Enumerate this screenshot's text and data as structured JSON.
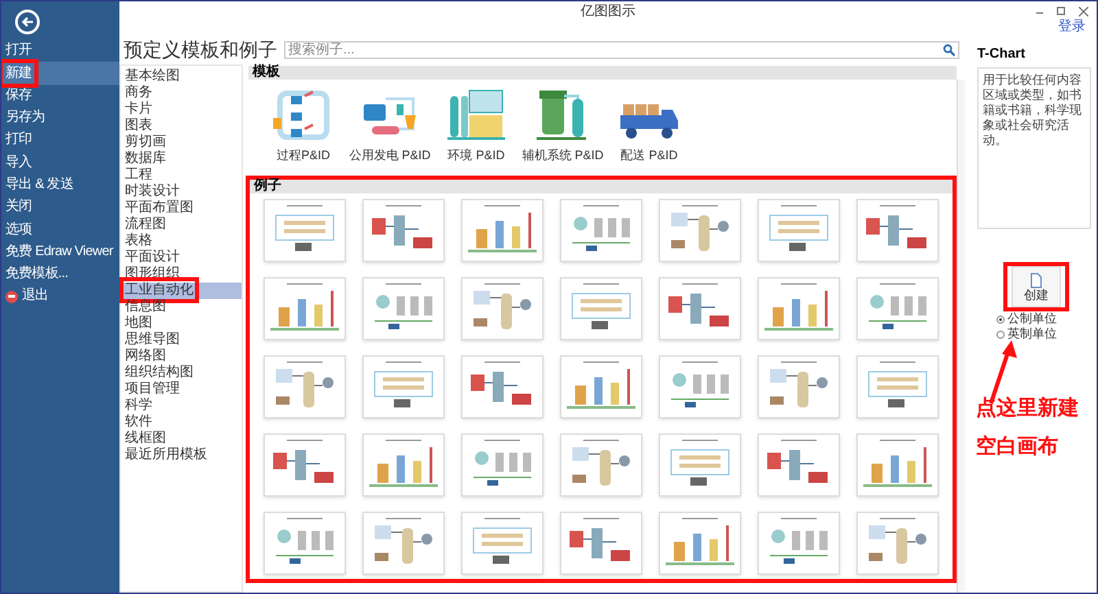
{
  "window": {
    "title": "亿图图示",
    "login": "登录"
  },
  "file_menu": [
    {
      "label": "打开",
      "selected": false,
      "kind": "plain"
    },
    {
      "label": "新建",
      "selected": true,
      "kind": "plain"
    },
    {
      "label": "保存",
      "selected": false,
      "kind": "plain"
    },
    {
      "label": "另存为",
      "selected": false,
      "kind": "plain"
    },
    {
      "label": "打印",
      "selected": false,
      "kind": "plain"
    },
    {
      "label": "导入",
      "selected": false,
      "kind": "plain"
    },
    {
      "label": "导出 & 发送",
      "selected": false,
      "kind": "plain"
    },
    {
      "label": "关闭",
      "selected": false,
      "kind": "plain"
    },
    {
      "label": "选项",
      "selected": false,
      "kind": "plain"
    },
    {
      "label": "免费 Edraw Viewer",
      "selected": false,
      "kind": "plain"
    },
    {
      "label": "免费模板...",
      "selected": false,
      "kind": "plain"
    },
    {
      "label": "退出",
      "selected": false,
      "kind": "exit"
    }
  ],
  "page_title": "预定义模板和例子",
  "search": {
    "placeholder": "搜索例子..."
  },
  "categories": [
    {
      "label": "基本绘图",
      "selected": false
    },
    {
      "label": "商务",
      "selected": false
    },
    {
      "label": "卡片",
      "selected": false
    },
    {
      "label": "图表",
      "selected": false
    },
    {
      "label": "剪切画",
      "selected": false
    },
    {
      "label": "数据库",
      "selected": false
    },
    {
      "label": "工程",
      "selected": false
    },
    {
      "label": "时装设计",
      "selected": false
    },
    {
      "label": "平面布置图",
      "selected": false
    },
    {
      "label": "流程图",
      "selected": false
    },
    {
      "label": "表格",
      "selected": false
    },
    {
      "label": "平面设计",
      "selected": false
    },
    {
      "label": "图形组织",
      "selected": false
    },
    {
      "label": "工业自动化",
      "selected": true
    },
    {
      "label": "信息图",
      "selected": false
    },
    {
      "label": "地图",
      "selected": false
    },
    {
      "label": "思维导图",
      "selected": false
    },
    {
      "label": "网络图",
      "selected": false
    },
    {
      "label": "组织结构图",
      "selected": false
    },
    {
      "label": "项目管理",
      "selected": false
    },
    {
      "label": "科学",
      "selected": false
    },
    {
      "label": "软件",
      "selected": false
    },
    {
      "label": "线框图",
      "selected": false
    },
    {
      "label": "最近所用模板",
      "selected": false
    }
  ],
  "templates": {
    "title": "模板",
    "items": [
      {
        "label": "过程P&ID",
        "kind": "process"
      },
      {
        "label": "公用发电 P&ID",
        "kind": "power"
      },
      {
        "label": "环境 P&ID",
        "kind": "environment"
      },
      {
        "label": "辅机系统 P&ID",
        "kind": "auxiliary"
      },
      {
        "label": "配送 P&ID",
        "kind": "delivery"
      }
    ]
  },
  "examples": {
    "title": "例子"
  },
  "details": {
    "title": "T-Chart",
    "description": "用于比较任何内容区域或类型，如书籍或书籍，科学现象或社会研究活动。",
    "create_button": "创建",
    "units": [
      {
        "label": "公制单位",
        "selected": true
      },
      {
        "label": "英制单位",
        "selected": false
      }
    ]
  },
  "annotation": {
    "lines": [
      "点这里新建",
      "空白画布"
    ]
  }
}
